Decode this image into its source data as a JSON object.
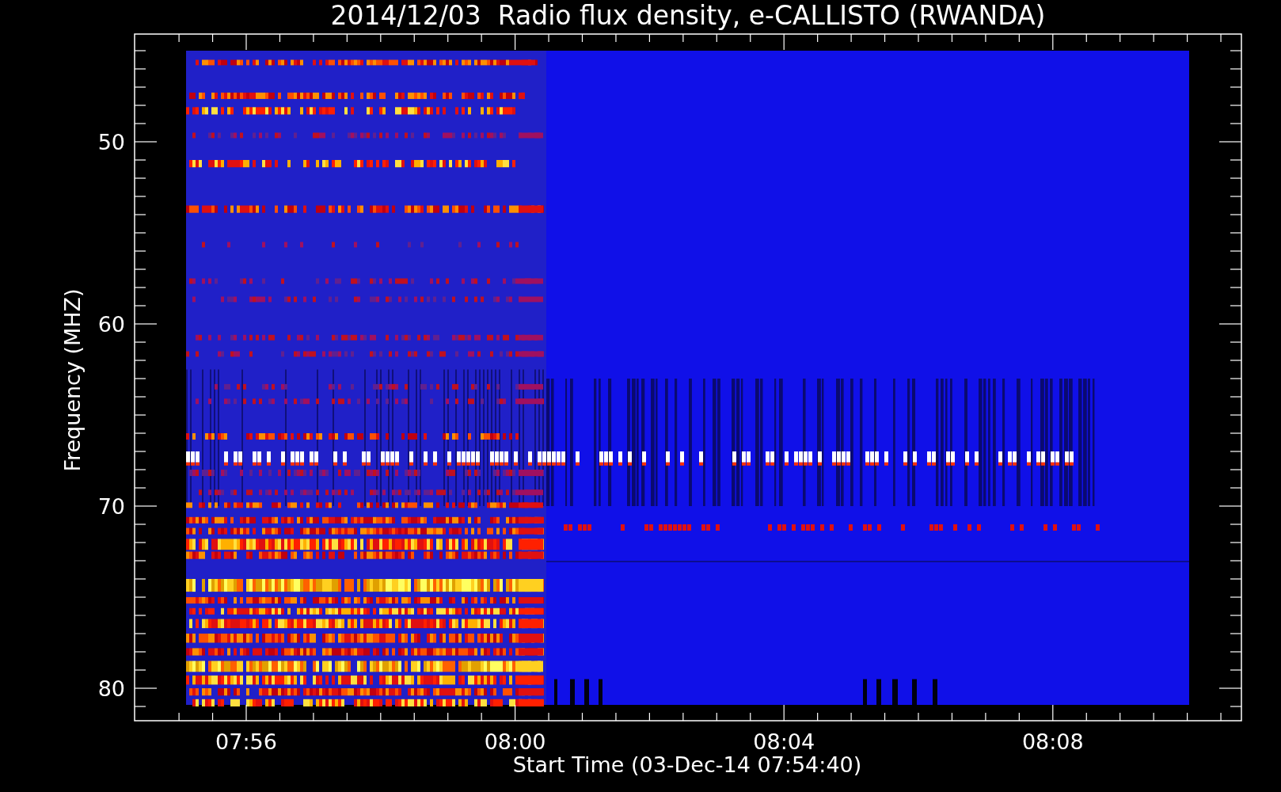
{
  "title": "2014/12/03  Radio flux density, e-CALLISTO (RWANDA)",
  "y_axis": {
    "label": "Frequency (MHZ)",
    "ticks": [
      "50",
      "60",
      "70",
      "80"
    ]
  },
  "x_axis": {
    "label": "Start Time (03-Dec-14 07:54:40)",
    "ticks": [
      "07:56",
      "08:00",
      "08:04",
      "08:08"
    ]
  }
}
